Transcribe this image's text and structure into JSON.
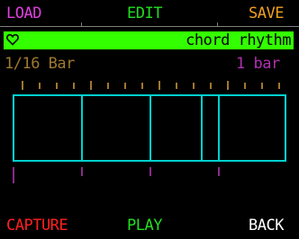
{
  "top_bar": {
    "load_label": "LOAD",
    "edit_label": "EDIT",
    "save_label": "SAVE"
  },
  "title_bar": {
    "icon": "heart-outline-icon",
    "title": "chord rhythm"
  },
  "params": {
    "resolution": "1/16 Bar",
    "length": "1 bar"
  },
  "bottom_bar": {
    "capture_label": "CAPTURE",
    "play_label": "PLAY",
    "back_label": "BACK"
  },
  "rhythm": {
    "steps": 16,
    "onsets": [
      0,
      4,
      8,
      11,
      12
    ],
    "beats": 4
  },
  "colors": {
    "load": "#e040e0",
    "edit": "#20e020",
    "save": "#f0a020",
    "title_bar_bg": "#33ff00",
    "resolution": "#a07830",
    "length": "#b030b0",
    "step_tick": "#a07830",
    "grid": "#00d0d0",
    "beat_marker": "#8a2a8a",
    "capture": "#ff2020",
    "play": "#20e020",
    "back": "#ffffff"
  }
}
